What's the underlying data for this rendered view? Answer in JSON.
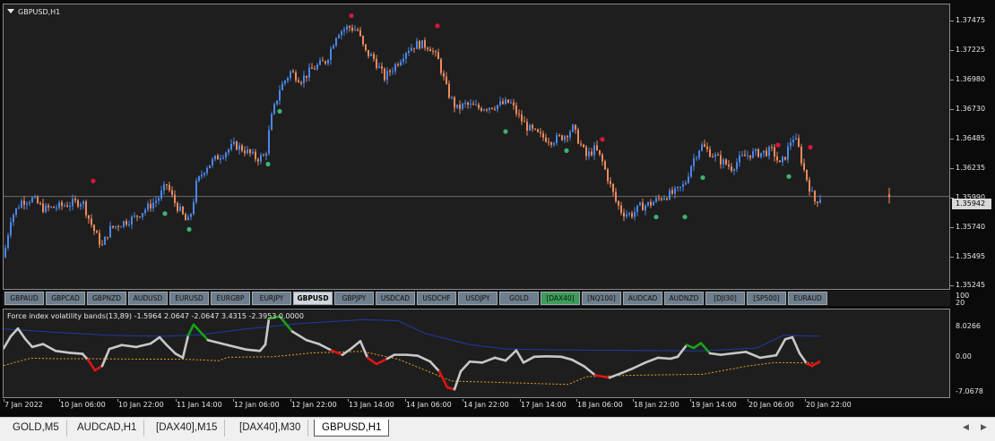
{
  "window": {
    "symbol_title": "GBPUSD,H1"
  },
  "main_chart": {
    "current_price_label": "1.35942",
    "current_price": 1.35942,
    "price_axis_labels": [
      "1.37475",
      "1.37225",
      "1.36980",
      "1.36730",
      "1.36485",
      "1.36235",
      "1.35990",
      "1.35740",
      "1.35495",
      "1.35245"
    ]
  },
  "symbols": [
    {
      "label": "GBPAUD",
      "state": "normal"
    },
    {
      "label": "GBPCAD",
      "state": "normal"
    },
    {
      "label": "GBPNZD",
      "state": "normal"
    },
    {
      "label": "AUDUSD",
      "state": "normal"
    },
    {
      "label": "EURUSD",
      "state": "normal"
    },
    {
      "label": "EURGBP",
      "state": "normal"
    },
    {
      "label": "EURJPY",
      "state": "normal"
    },
    {
      "label": "GBPUSD",
      "state": "active"
    },
    {
      "label": "GBPJPY",
      "state": "normal"
    },
    {
      "label": "USDCAD",
      "state": "normal"
    },
    {
      "label": "USDCHF",
      "state": "normal"
    },
    {
      "label": "USDJPY",
      "state": "normal"
    },
    {
      "label": "GOLD",
      "state": "normal"
    },
    {
      "label": "[DAX40]",
      "state": "highlight"
    },
    {
      "label": "[NQ100]",
      "state": "normal"
    },
    {
      "label": "AUDCAD",
      "state": "normal"
    },
    {
      "label": "AUDNZD",
      "state": "normal"
    },
    {
      "label": "[DJI30]",
      "state": "normal"
    },
    {
      "label": "[SP500]",
      "state": "normal"
    },
    {
      "label": "EURAUD",
      "state": "normal"
    }
  ],
  "indicator": {
    "title": "Force index volatility bands(13,89) -1.5964 2.0647 -2.0647 3.4315 -2.3953 0.0000",
    "axis_labels": [
      "100",
      "20",
      "8.0266",
      "0.00",
      "-7.0678"
    ]
  },
  "time_axis": [
    "7 Jan 2022",
    "10 Jan 06:00",
    "10 Jan 22:00",
    "11 Jan 14:00",
    "12 Jan 06:00",
    "12 Jan 22:00",
    "13 Jan 14:00",
    "14 Jan 06:00",
    "14 Jan 22:00",
    "17 Jan 14:00",
    "18 Jan 06:00",
    "18 Jan 22:00",
    "19 Jan 14:00",
    "20 Jan 06:00",
    "20 Jan 22:00"
  ],
  "tabs": [
    {
      "label": "GOLD,M5",
      "active": false
    },
    {
      "label": "AUDCAD,H1",
      "active": false
    },
    {
      "label": "[DAX40],M15",
      "active": false
    },
    {
      "label": "[DAX40],M30",
      "active": false
    },
    {
      "label": "GBPUSD,H1",
      "active": true
    }
  ],
  "colors": {
    "bull": "#4a86e8",
    "bear": "#f08a5d",
    "up_signal": "#3cb371",
    "down_signal": "#dc143c",
    "upper_band": "#1e3aa8",
    "lower_band": "#e6a020",
    "fi_neutral": "#c8c8c8",
    "fi_up": "#1aa01a",
    "fi_down": "#e01414"
  },
  "chart_data": {
    "type": "candlestick",
    "y_range": [
      1.3512,
      1.3765
    ],
    "close_path": [
      [
        0,
        1.354
      ],
      [
        8,
        1.3575
      ],
      [
        20,
        1.359
      ],
      [
        32,
        1.3592
      ],
      [
        45,
        1.3583
      ],
      [
        60,
        1.3585
      ],
      [
        75,
        1.3588
      ],
      [
        88,
        1.359
      ],
      [
        95,
        1.3575
      ],
      [
        103,
        1.356
      ],
      [
        110,
        1.355
      ],
      [
        118,
        1.3565
      ],
      [
        130,
        1.357
      ],
      [
        145,
        1.3575
      ],
      [
        160,
        1.3584
      ],
      [
        172,
        1.3592
      ],
      [
        182,
        1.3605
      ],
      [
        190,
        1.359
      ],
      [
        198,
        1.358
      ],
      [
        205,
        1.357
      ],
      [
        210,
        1.3582
      ],
      [
        215,
        1.3605
      ],
      [
        225,
        1.362
      ],
      [
        240,
        1.363
      ],
      [
        258,
        1.364
      ],
      [
        270,
        1.3635
      ],
      [
        282,
        1.3628
      ],
      [
        292,
        1.363
      ],
      [
        298,
        1.3662
      ],
      [
        308,
        1.369
      ],
      [
        320,
        1.3705
      ],
      [
        332,
        1.3698
      ],
      [
        345,
        1.3708
      ],
      [
        360,
        1.3715
      ],
      [
        372,
        1.374
      ],
      [
        385,
        1.3745
      ],
      [
        395,
        1.3742
      ],
      [
        403,
        1.3723
      ],
      [
        412,
        1.3718
      ],
      [
        425,
        1.37
      ],
      [
        438,
        1.3712
      ],
      [
        450,
        1.3725
      ],
      [
        462,
        1.373
      ],
      [
        475,
        1.3728
      ],
      [
        485,
        1.3715
      ],
      [
        495,
        1.3688
      ],
      [
        505,
        1.3672
      ],
      [
        515,
        1.3676
      ],
      [
        530,
        1.3673
      ],
      [
        548,
        1.3675
      ],
      [
        565,
        1.3678
      ],
      [
        575,
        1.3665
      ],
      [
        585,
        1.3655
      ],
      [
        598,
        1.3648
      ],
      [
        612,
        1.3644
      ],
      [
        625,
        1.3648
      ],
      [
        635,
        1.3655
      ],
      [
        642,
        1.3643
      ],
      [
        650,
        1.363
      ],
      [
        660,
        1.3637
      ],
      [
        668,
        1.3625
      ],
      [
        676,
        1.3606
      ],
      [
        683,
        1.359
      ],
      [
        690,
        1.358
      ],
      [
        700,
        1.3578
      ],
      [
        710,
        1.3585
      ],
      [
        722,
        1.3588
      ],
      [
        735,
        1.3594
      ],
      [
        750,
        1.3598
      ],
      [
        760,
        1.3605
      ],
      [
        768,
        1.3625
      ],
      [
        778,
        1.364
      ],
      [
        790,
        1.3632
      ],
      [
        800,
        1.3626
      ],
      [
        812,
        1.362
      ],
      [
        822,
        1.3628
      ],
      [
        832,
        1.3632
      ],
      [
        845,
        1.3633
      ],
      [
        858,
        1.3635
      ],
      [
        866,
        1.3622
      ],
      [
        872,
        1.363
      ],
      [
        880,
        1.3648
      ],
      [
        886,
        1.364
      ],
      [
        892,
        1.362
      ],
      [
        900,
        1.36
      ],
      [
        905,
        1.359
      ],
      [
        912,
        1.3594
      ]
    ],
    "up_signals": [
      [
        180,
        1.3579
      ],
      [
        207,
        1.3565
      ],
      [
        295,
        1.3623
      ],
      [
        308,
        1.367
      ],
      [
        560,
        1.3652
      ],
      [
        628,
        1.3635
      ],
      [
        728,
        1.3576
      ],
      [
        760,
        1.3576
      ],
      [
        780,
        1.3611
      ],
      [
        876,
        1.3612
      ]
    ],
    "down_signals": [
      [
        100,
        1.3608
      ],
      [
        388,
        1.3755
      ],
      [
        484,
        1.3746
      ],
      [
        668,
        1.3645
      ],
      [
        864,
        1.364
      ],
      [
        900,
        1.3638
      ]
    ],
    "indicator": {
      "y_range": [
        -8.5,
        9.5
      ],
      "upper_band": [
        [
          0,
          5.5
        ],
        [
          60,
          4.8
        ],
        [
          120,
          4.2
        ],
        [
          180,
          4.0
        ],
        [
          220,
          4.3
        ],
        [
          270,
          5.5
        ],
        [
          330,
          6.6
        ],
        [
          400,
          7.4
        ],
        [
          440,
          7.2
        ],
        [
          470,
          4.6
        ],
        [
          520,
          2.3
        ],
        [
          560,
          1.4
        ],
        [
          620,
          1.2
        ],
        [
          700,
          1.1
        ],
        [
          780,
          1.0
        ],
        [
          840,
          1.6
        ],
        [
          870,
          4.2
        ],
        [
          910,
          4.0
        ]
      ],
      "lower_band": [
        [
          0,
          -2.0
        ],
        [
          30,
          -0.5
        ],
        [
          60,
          -0.6
        ],
        [
          100,
          -0.6
        ],
        [
          150,
          -0.7
        ],
        [
          200,
          -0.7
        ],
        [
          240,
          -1.0
        ],
        [
          250,
          -0.3
        ],
        [
          300,
          -0.2
        ],
        [
          345,
          0.6
        ],
        [
          400,
          0.9
        ],
        [
          440,
          -0.7
        ],
        [
          500,
          -5.2
        ],
        [
          560,
          -5.5
        ],
        [
          630,
          -5.9
        ],
        [
          650,
          -4.3
        ],
        [
          700,
          -4.0
        ],
        [
          780,
          -3.8
        ],
        [
          830,
          -2.1
        ],
        [
          860,
          -1.4
        ],
        [
          910,
          -1.5
        ]
      ],
      "force_index": [
        [
          0,
          1.5
        ],
        [
          8,
          4.0
        ],
        [
          16,
          5.6
        ],
        [
          24,
          3.5
        ],
        [
          32,
          1.8
        ],
        [
          44,
          2.4
        ],
        [
          58,
          1.0
        ],
        [
          74,
          0.6
        ],
        [
          88,
          0.4
        ],
        [
          94,
          -0.8
        ],
        [
          102,
          -3.0
        ],
        [
          110,
          -2.1
        ],
        [
          118,
          1.4
        ],
        [
          132,
          2.2
        ],
        [
          148,
          1.8
        ],
        [
          164,
          2.5
        ],
        [
          174,
          3.8
        ],
        [
          182,
          2.2
        ],
        [
          192,
          0.4
        ],
        [
          200,
          -0.4
        ],
        [
          206,
          4.2
        ],
        [
          212,
          6.4
        ],
        [
          228,
          3.2
        ],
        [
          250,
          2.2
        ],
        [
          270,
          1.3
        ],
        [
          286,
          1.0
        ],
        [
          292,
          2.3
        ],
        [
          296,
          7.6
        ],
        [
          308,
          8.1
        ],
        [
          322,
          5.0
        ],
        [
          338,
          3.2
        ],
        [
          352,
          2.4
        ],
        [
          366,
          1.1
        ],
        [
          378,
          0.2
        ],
        [
          388,
          1.5
        ],
        [
          398,
          3.0
        ],
        [
          406,
          -0.4
        ],
        [
          416,
          -1.7
        ],
        [
          428,
          -0.6
        ],
        [
          436,
          0.2
        ],
        [
          450,
          0.2
        ],
        [
          462,
          0.0
        ],
        [
          476,
          -1.2
        ],
        [
          486,
          -3.2
        ],
        [
          495,
          -6.5
        ],
        [
          503,
          -6.9
        ],
        [
          510,
          -3.2
        ],
        [
          520,
          -1.2
        ],
        [
          534,
          -1.4
        ],
        [
          548,
          -0.4
        ],
        [
          560,
          -1.0
        ],
        [
          572,
          1.1
        ],
        [
          580,
          -1.4
        ],
        [
          592,
          -0.2
        ],
        [
          606,
          -0.1
        ],
        [
          622,
          -0.2
        ],
        [
          634,
          -0.8
        ],
        [
          648,
          -2.2
        ],
        [
          660,
          -4.0
        ],
        [
          676,
          -4.5
        ],
        [
          690,
          -3.5
        ],
        [
          702,
          -2.6
        ],
        [
          716,
          -1.4
        ],
        [
          730,
          -0.4
        ],
        [
          744,
          -0.6
        ],
        [
          752,
          -0.2
        ],
        [
          762,
          2.2
        ],
        [
          770,
          1.6
        ],
        [
          778,
          2.6
        ],
        [
          788,
          0.5
        ],
        [
          800,
          0.2
        ],
        [
          814,
          0.5
        ],
        [
          828,
          0.8
        ],
        [
          844,
          -0.4
        ],
        [
          862,
          0.1
        ],
        [
          872,
          3.4
        ],
        [
          880,
          3.8
        ],
        [
          888,
          0.5
        ],
        [
          896,
          -1.6
        ],
        [
          902,
          -2.1
        ],
        [
          910,
          -1.2
        ]
      ]
    }
  }
}
